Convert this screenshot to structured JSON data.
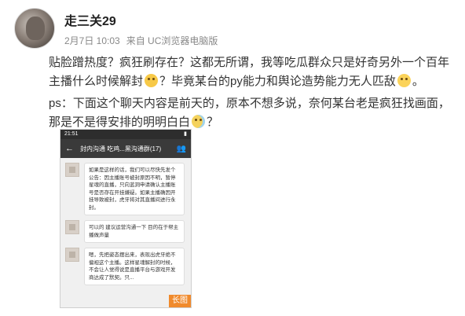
{
  "post": {
    "username": "走三关29",
    "date": "2月7日 10:03",
    "source": "来自 UC浏览器电脑版",
    "paragraph1_a": "贴脸蹭热度？疯狂刷存在？这都无所谓，我等吃瓜群众只是好奇另外一个百年主播什么时候解封",
    "paragraph1_b": "？毕竟某台的py能力和舆论造势能力无人匹敌",
    "paragraph1_c": "。",
    "paragraph2_a": "ps：下面这个聊天内容是前天的，原本不想多说，奈何某台老是疯狂找画面，那是不是得安排的明明白白",
    "paragraph2_b": "？",
    "emojis": [
      "doge-icon",
      "laugh-icon",
      "sweat-smile-icon"
    ]
  },
  "chat": {
    "time": "21:51",
    "title": "封内沟通 吃鸡...黑沟通群(17)",
    "messages": [
      "如果是这样的话，我们可以尽快先发个公告：因主播账号被封原因不明，暂停星魂的直播，只向蓝洞申请确认主播账号是否存在开挂嫌疑。如果主播确因开挂导致被封，虎牙将对其直播间进行永封。",
      "可以的 建议运营沟通一下 目的在于帮主播做声量",
      "嗯，先把姿态摆出来，表现出虎牙绝不偏袒这个主播。这样星魂解封的时候，不会让人觉得说是直播平台与游戏开发商达成了默契。只..."
    ],
    "long_image_label": "长图"
  }
}
